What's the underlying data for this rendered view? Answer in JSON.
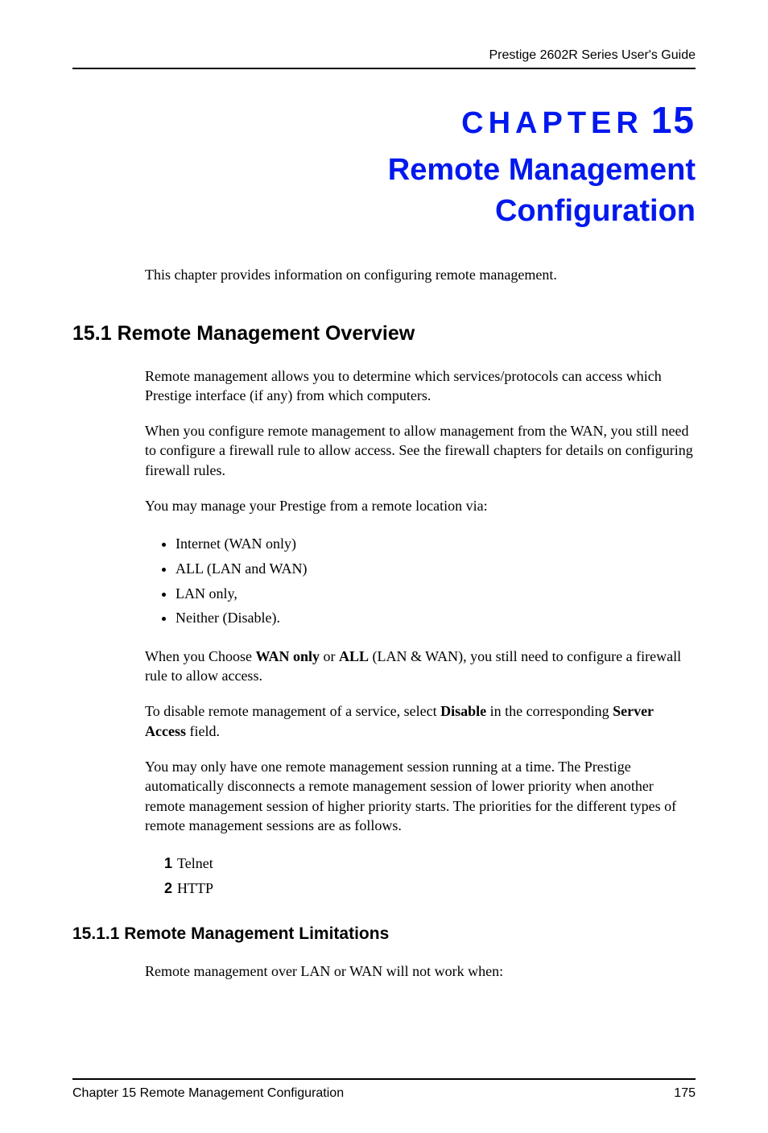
{
  "header": "Prestige 2602R Series User's Guide",
  "chapter": {
    "kicker": "CHAPTER",
    "number": "15",
    "title_line1": "Remote Management",
    "title_line2": "Configuration"
  },
  "intro": "This chapter provides information on configuring remote management.",
  "section1": {
    "heading": "15.1  Remote Management Overview",
    "p1": "Remote management allows you to determine which services/protocols can access which Prestige interface (if any) from which computers.",
    "p2": "When you configure remote management to allow management from the WAN, you still need to configure a firewall rule to allow access. See the firewall chapters for details on configuring firewall rules.",
    "p3": "You may manage your Prestige from a remote location via:",
    "bullets": {
      "b1": "Internet (WAN only)",
      "b2": "ALL (LAN and WAN)",
      "b3": "LAN only,",
      "b4": "Neither (Disable)."
    },
    "p4_pre": "When you Choose ",
    "p4_b1": "WAN only",
    "p4_mid1": " or ",
    "p4_b2": "ALL",
    "p4_post": " (LAN & WAN), you still need to configure a firewall rule to allow access.",
    "p5_pre": "To disable remote management of a service, select ",
    "p5_b1": "Disable",
    "p5_mid": " in the corresponding ",
    "p5_b2": "Server Access",
    "p5_post": " field.",
    "p6": "You may only have one remote management session running at a time. The Prestige automatically disconnects a remote management session of lower priority when another remote management session of higher priority starts. The priorities for the different types of remote management sessions are as follows.",
    "ord": {
      "n1": "1",
      "i1": "Telnet",
      "n2": "2",
      "i2": "HTTP"
    }
  },
  "section2": {
    "heading": "15.1.1  Remote Management Limitations",
    "p1": "Remote management over LAN or WAN will not work when:"
  },
  "footer": {
    "left": "Chapter 15 Remote Management Configuration",
    "right": "175"
  }
}
